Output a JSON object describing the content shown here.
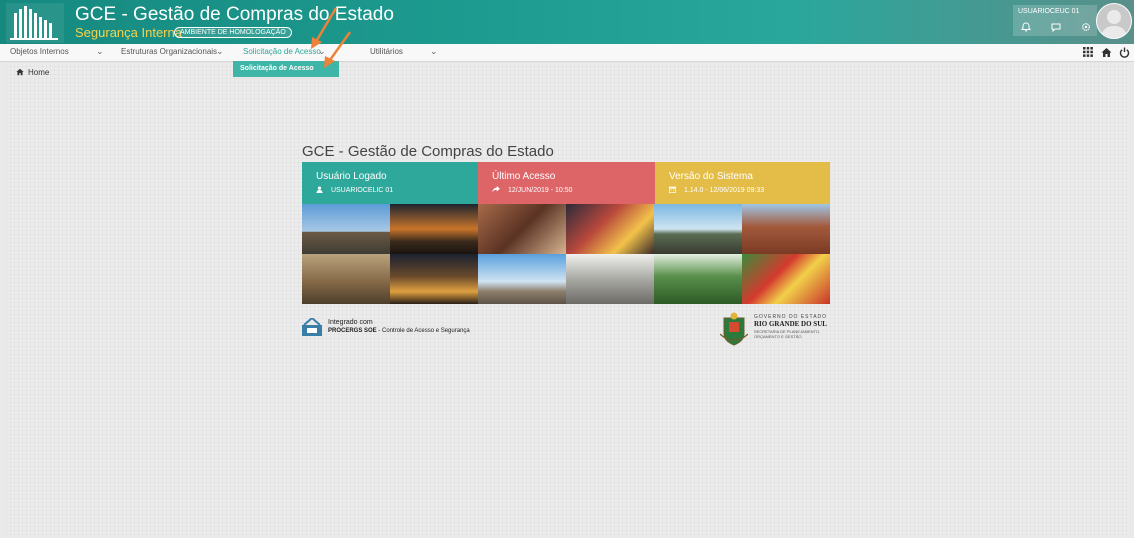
{
  "header": {
    "title": "GCE - Gestão de Compras do Estado",
    "subtitle": "Segurança Interna",
    "environment_badge": "AMBIENTE DE HOMOLOGAÇÃO",
    "user_name": "USUARIOCEUC 01",
    "icons": [
      "bell-icon",
      "chat-icon",
      "gear-icon"
    ]
  },
  "nav": {
    "items": [
      {
        "label": "Objetos Internos"
      },
      {
        "label": "Estruturas Organizacionais"
      },
      {
        "label": "Solicitação de Acesso"
      },
      {
        "label": "Utilitários"
      }
    ],
    "active_index": 2,
    "right_icons": [
      "apps-grid-icon",
      "home-icon",
      "power-icon"
    ]
  },
  "dropdown": {
    "items": [
      {
        "label": "Solicitação de Acesso"
      }
    ]
  },
  "breadcrumb": {
    "home_label": "Home"
  },
  "main": {
    "title": "GCE - Gestão de Compras do Estado",
    "cards": [
      {
        "title": "Usuário Logado",
        "value": "USUARIOCELIC 01",
        "icon": "user-icon",
        "color": "#2fa89c"
      },
      {
        "title": "Último Acesso",
        "value": "12/JUN/2019 - 10:50",
        "icon": "share-arrow-icon",
        "color": "#dd6467"
      },
      {
        "title": "Versão do Sistema",
        "value": "1.14.0 - 12/06/2019 09:33",
        "icon": "calendar-icon",
        "color": "#e3bd47"
      }
    ]
  },
  "footer": {
    "integrado_label": "Integrado com",
    "procergs_name": "PROCERGS SOE",
    "procergs_desc": " - Controle de Acesso e Segurança",
    "gov_line1": "GOVERNO DO ESTADO",
    "gov_line2": "RIO GRANDE DO SUL",
    "gov_line3": "SECRETARIA DE PLANEJAMENTO,",
    "gov_line4": "ORÇAMENTO E GESTÃO"
  },
  "colors": {
    "accent": "#2ba79c",
    "arrow": "#ef8236"
  }
}
